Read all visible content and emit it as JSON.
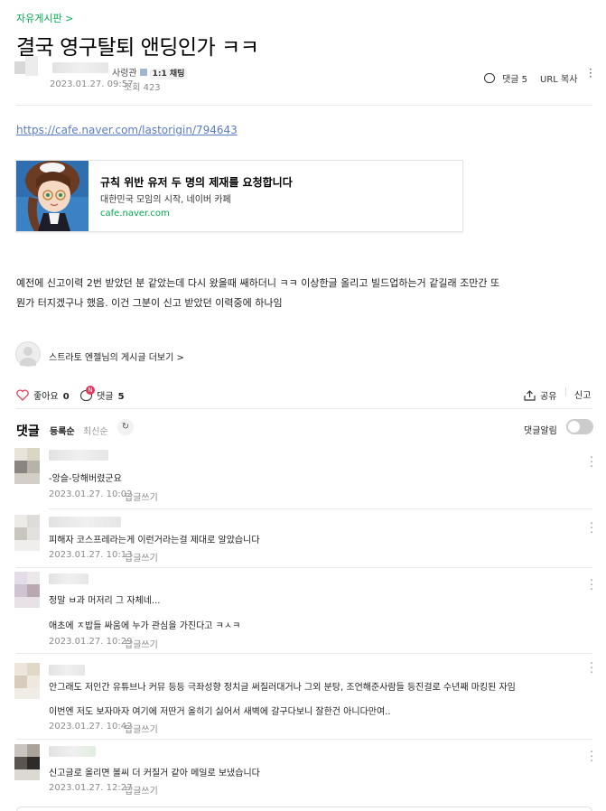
{
  "board": {
    "name": "자유게시판 >"
  },
  "post": {
    "title": "결국 영구탈퇴 앤딩인가 ㅋㅋ",
    "author_rank": "사령관",
    "chat_badge": "1:1 채팅",
    "date": "2023.01.27. 09:57",
    "views_label": "조회 423",
    "comments_label": "댓글 5",
    "url_copy": "URL 복사",
    "link": "https://cafe.naver.com/lastorigin/794643",
    "og": {
      "title": "규칙 위반 유저 두 명의 제재를 요청합니다",
      "desc": "대한민국 모임의 시작, 네이버 카페",
      "url": "cafe.naver.com"
    },
    "body_lines": [
      "예전에 신고이력 2번 받았던 분 같았는데 다시 왔을때 쌔하더니 ㅋㅋ 이상한글 올리고 빌드업하는거 같길래 조만간 또",
      "뭔가 터지겠구나 했음.  이건 그분이 신고 받았던 이력중에 하나임"
    ],
    "more_posts": "스트라토 엔젤님의 게시글 더보기 >"
  },
  "actions": {
    "like": "좋아요",
    "like_count": "0",
    "comment": "댓글",
    "comment_count": "5",
    "new_badge": "N",
    "share": "공유",
    "report": "신고"
  },
  "comments_section": {
    "heading": "댓글",
    "sort_registered": "등록순",
    "sort_latest": "최신순",
    "refresh_icon": "refresh-icon",
    "notify_label": "댓글알림"
  },
  "comments": [
    {
      "lines": [
        "-앙슬-당해버렸군요"
      ],
      "date": "2023.01.27. 10:02",
      "reply": "답글쓰기"
    },
    {
      "lines": [
        "피해자 코스프레라는게 이런거라는걸 제대로 알았습니다"
      ],
      "date": "2023.01.27. 10:13",
      "reply": "답글쓰기"
    },
    {
      "lines": [
        "정말 ㅂ과 머저리 그 자체네...",
        "애초에 ㅈ밥들 싸움에 누가 관심을 가진다고 ㅋㅅㅋ"
      ],
      "date": "2023.01.27. 10:29",
      "reply": "답글쓰기"
    },
    {
      "lines": [
        "안그래도 저인간 유튜브나 커뮤 등등 극좌성향 정치글 써질러대거나 그외 분탕, 조언해준사람들 등진걸로 수년째 마킹된 자임",
        "이번엔 저도 보자마자 여기에 저딴거 올히기 싫어서 새벽에 갈구다보니 잘한건 아니다만여.."
      ],
      "date": "2023.01.27. 10:42",
      "reply": "답글쓰기"
    },
    {
      "lines": [
        "신고글로 올리면 볼씨 더 커질거 같아 메일로 보냈습니다"
      ],
      "date": "2023.01.27. 12:27",
      "reply": "답글쓰기"
    }
  ]
}
